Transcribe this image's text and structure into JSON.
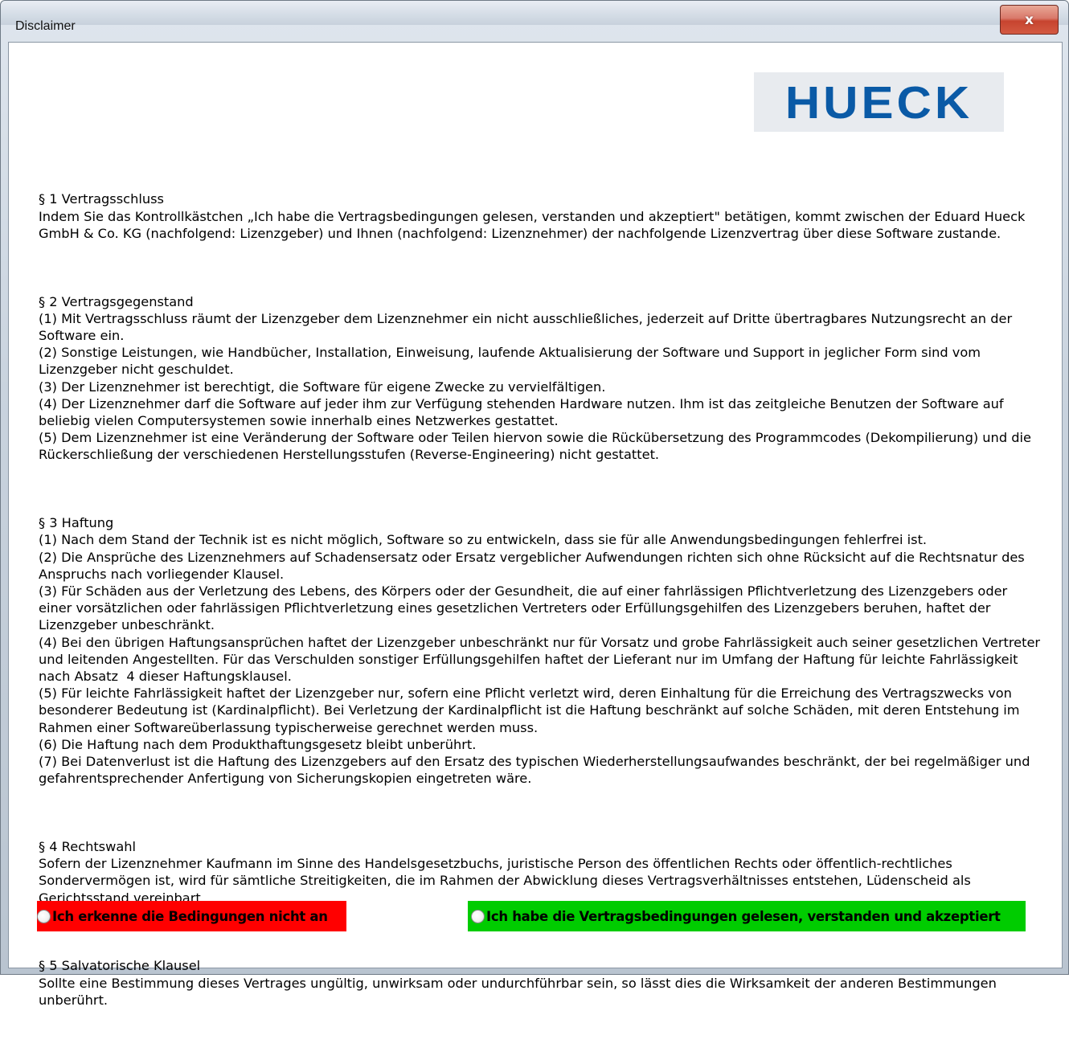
{
  "window": {
    "title": "Disclaimer",
    "close_symbol": "x"
  },
  "logo": {
    "text": "HUECK",
    "color": "#0a5aa6"
  },
  "terms": {
    "s1_heading": "§ 1 Vertragsschluss",
    "s1_text": "Indem Sie das Kontrollkästchen „Ich habe die Vertragsbedingungen gelesen, verstanden und akzeptiert\" betätigen, kommt zwischen der Eduard Hueck GmbH & Co. KG (nachfolgend: Lizenzgeber) und Ihnen (nachfolgend: Lizenznehmer) der nachfolgende Lizenzvertrag über diese Software zustande.",
    "s2_heading": "§ 2 Vertragsgegenstand",
    "s2_items": [
      "(1) Mit Vertragsschluss räumt der Lizenzgeber dem Lizenznehmer ein nicht ausschließliches, jederzeit auf Dritte übertragbares Nutzungsrecht an der Software ein.",
      "(2) Sonstige Leistungen, wie Handbücher, Installation, Einweisung, laufende Aktualisierung der Software und Support in jeglicher Form sind vom Lizenzgeber nicht geschuldet.",
      "(3) Der Lizenznehmer ist berechtigt, die Software für eigene Zwecke zu vervielfältigen.",
      "(4) Der Lizenznehmer darf die Software auf jeder ihm zur Verfügung stehenden Hardware nutzen. Ihm ist das zeitgleiche Benutzen der Software auf beliebig vielen Computersystemen sowie innerhalb eines Netzwerkes gestattet.",
      "(5) Dem Lizenznehmer ist eine Veränderung der Software oder Teilen hiervon sowie die Rückübersetzung des Programmcodes (Dekompilierung) und die Rückerschließung der verschiedenen Herstellungsstufen (Reverse-Engineering) nicht gestattet."
    ],
    "s3_heading": "§ 3 Haftung",
    "s3_items": [
      "(1) Nach dem Stand der Technik ist es nicht möglich, Software so zu entwickeln, dass sie für alle Anwendungsbedingungen fehlerfrei ist.",
      "(2) Die Ansprüche des Lizenznehmers auf Schadensersatz oder Ersatz vergeblicher Aufwendungen richten sich ohne Rücksicht auf die Rechtsnatur des Anspruchs nach vorliegender Klausel.",
      "(3) Für Schäden aus der Verletzung des Lebens, des Körpers oder der Gesundheit, die auf einer fahrlässigen Pflichtverletzung des Lizenzgebers oder einer vorsätzlichen oder fahrlässigen Pflichtverletzung eines gesetzlichen Vertreters oder Erfüllungsgehilfen des Lizenzgebers beruhen, haftet der Lizenzgeber unbeschränkt.",
      "(4) Bei den übrigen Haftungsansprüchen haftet der Lizenzgeber unbeschränkt nur für Vorsatz und grobe Fahrlässigkeit auch seiner gesetzlichen Vertreter und leitenden Angestellten. Für das Verschulden sonstiger Erfüllungsgehilfen haftet der Lieferant nur im Umfang der Haftung für leichte Fahrlässigkeit nach Absatz  4 dieser Haftungsklausel.",
      "(5) Für leichte Fahrlässigkeit haftet der Lizenzgeber nur, sofern eine Pflicht verletzt wird, deren Einhaltung für die Erreichung des Vertragszwecks von besonderer Bedeutung ist (Kardinalpflicht). Bei Verletzung der Kardinalpflicht ist die Haftung beschränkt auf solche Schäden, mit deren Entstehung im Rahmen einer Softwareüberlassung typischerweise gerechnet werden muss.",
      "(6) Die Haftung nach dem Produkthaftungsgesetz bleibt unberührt.",
      "(7) Bei Datenverlust ist die Haftung des Lizenzgebers auf den Ersatz des typischen Wiederherstellungsaufwandes beschränkt, der bei regelmäßiger und gefahrentsprechender Anfertigung von Sicherungskopien eingetreten wäre."
    ],
    "s4_heading": "§ 4 Rechtswahl",
    "s4_text": "Sofern der Lizenznehmer Kaufmann im Sinne des Handelsgesetzbuchs, juristische Person des öffentlichen Rechts oder öffentlich-rechtliches Sondervermögen ist, wird für sämtliche Streitigkeiten, die im Rahmen der Abwicklung dieses Vertragsverhältnisses entstehen, Lüdenscheid als Gerichtsstand vereinbart.",
    "s5_heading": "§ 5 Salvatorische Klausel",
    "s5_text": "Sollte eine Bestimmung dieses Vertrages ungültig, unwirksam oder undurchführbar sein, so lässt dies die Wirksamkeit der anderen Bestimmungen unberührt."
  },
  "options": {
    "decline_label": "Ich erkenne die Bedingungen nicht an",
    "decline_color": "#ff0000",
    "decline_selected": false,
    "accept_label": "Ich habe die Vertragsbedingungen gelesen, verstanden und akzeptiert",
    "accept_color": "#00cc00",
    "accept_selected": false
  }
}
